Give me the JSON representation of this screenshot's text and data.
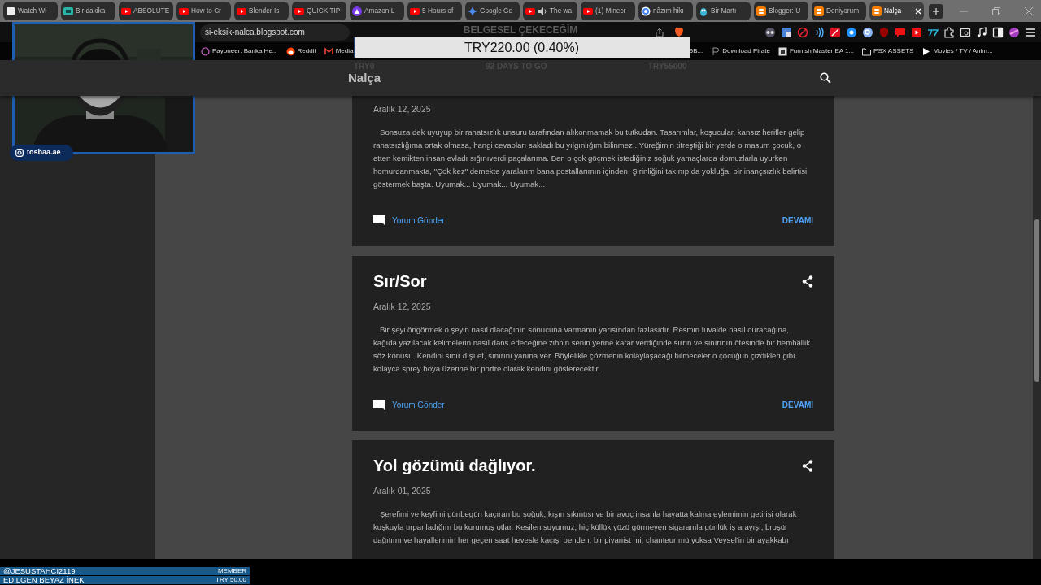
{
  "browser": {
    "tabs": [
      {
        "title": "Watch Wi",
        "selected": false,
        "audio": false
      },
      {
        "title": "Bir dakika",
        "selected": false,
        "audio": false
      },
      {
        "title": "ABSOLUTE",
        "selected": false,
        "audio": false
      },
      {
        "title": "How to Cr",
        "selected": false,
        "audio": false
      },
      {
        "title": "Blender Is",
        "selected": false,
        "audio": false
      },
      {
        "title": "QUICK TIP",
        "selected": false,
        "audio": false
      },
      {
        "title": "Amazon L",
        "selected": false,
        "audio": false
      },
      {
        "title": "5 Hours of",
        "selected": false,
        "audio": false
      },
      {
        "title": "Google Ge",
        "selected": false,
        "audio": false
      },
      {
        "title": "The wa",
        "selected": false,
        "audio": true
      },
      {
        "title": "(1) Minecr",
        "selected": false,
        "audio": false
      },
      {
        "title": "nâzım hikı",
        "selected": false,
        "audio": false
      },
      {
        "title": "Bir Martı",
        "selected": false,
        "audio": false
      },
      {
        "title": "Blogger: U",
        "selected": false,
        "audio": false
      },
      {
        "title": "Deniyorum",
        "selected": false,
        "audio": false
      },
      {
        "title": "Nalça",
        "selected": true,
        "audio": false
      }
    ],
    "address_bar": {
      "url": "si-eksik-nalca.blogspot.com"
    },
    "bookmarks_left": [
      "Payoneer: Banka He...",
      "Reddit",
      "Media"
    ],
    "bookmarks_right": [
      "GB...",
      "Download Pirate",
      "Furnish Master EA 1...",
      "PSX ASSETS",
      "Movies / TV / Anim..."
    ]
  },
  "blog": {
    "title": "Nalça",
    "posts": [
      {
        "date": "Aralık 12, 2025",
        "excerpt": "Sonsuza dek uyuyup bir rahatsızlık unsuru tarafından alıkonmamak bu tutkudan. Tasarımlar, koşucular, kansız herifler gelip rahatsızlığıma ortak olmasa, hangi cevapları sakladı bu yılgınlığım bilinmez.. Yüreğimin titreştiği bir yerde o masum çocuk, o etten kemikten insan evladı sığınıverdi paçalarıma. Ben o çok göçmek istediğiniz soğuk yamaçlarda domuzlarla uyurken homurdanmakta, \"Çok kez\" demekte yaralarım bana postallarımın içinden. Şirinliğini takınıp da yokluğa, bir inançsızlık belirtisi göstermek başta. Uyumak... Uyumak... Uyumak...",
        "comment_link": "Yorum Gönder",
        "more_link": "DEVAMI"
      },
      {
        "title": "Sır/Sor",
        "date": "Aralık 12, 2025",
        "excerpt": "Bir şeyi öngörmek o şeyin nasıl olacağının sonucuna varmanın yarısından fazlasıdır. Resmin tuvalde nasıl duracağına, kağıda yazılacak kelimelerin nasıl dans edeceğine zihnin senin yerine karar verdiğinde sırrın ve sınırının ötesinde bir hemhâllik söz konusu. Kendini sınır dışı et, sınırını yanına ver. Böylelikle çözmenin kolaylaşacağı bilmeceler o çocuğun çizdikleri gibi kolayca sprey boya üzerine bir portre olarak kendini gösterecektir.",
        "comment_link": "Yorum Gönder",
        "more_link": "DEVAMI"
      },
      {
        "title": "Yol gözümü dağlıyor.",
        "date": "Aralık 01, 2025",
        "excerpt": "Şerefimi ve keyfimi günbegün kaçıran bu soğuk, kışın sıkıntısı ve bir avuç insanla hayatta kalma eylemimin getirisi olarak kuşkuyla tırpanladığım bu kurumuş otlar. Kesilen suyumuz, hiç küllük yüzü görmeyen sigaramla günlük iş arayışı, broşür dağıtımı ve hayallerimin her geçen saat hevesle kaçışı benden, bir piyanist mi, chanteur mü yoksa Veysel'in bir ayakkabı"
      }
    ]
  },
  "stream_overlay": {
    "goal": {
      "title": "BELGESEL ÇEKECEĞİM",
      "reading": "TRY220.00 (0.40%)",
      "level": 0.004,
      "raised": "TRY0",
      "days_left": "92 DAYS TO GO",
      "target": "TRY55000"
    },
    "webcam": {
      "kind": "picture",
      "handle": "tosbaa.ae"
    },
    "events": [
      {
        "user": "@JESUSTAHCI2119",
        "tag": "MEMBER"
      },
      {
        "user": "EDILGEN BEYAZ İNEK",
        "tag": "TRY 50.00"
      }
    ]
  }
}
